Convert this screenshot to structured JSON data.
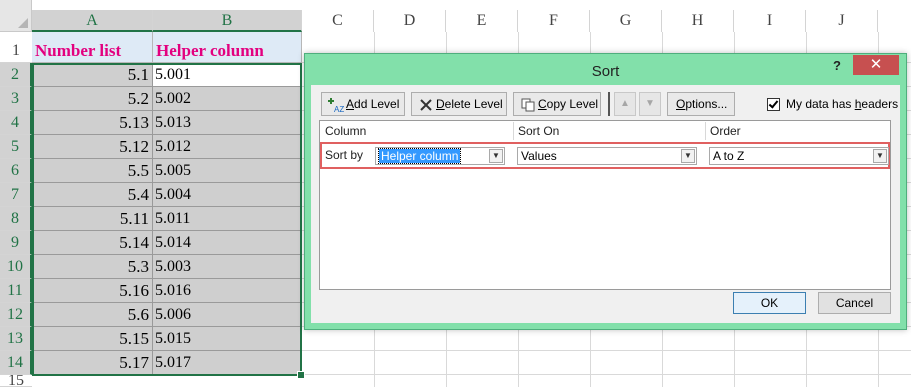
{
  "spreadsheet": {
    "columns": [
      "A",
      "B",
      "C",
      "D",
      "E",
      "F",
      "G",
      "H",
      "I",
      "J"
    ],
    "row_numbers": [
      "1",
      "2",
      "3",
      "4",
      "5",
      "6",
      "7",
      "8",
      "9",
      "10",
      "11",
      "12",
      "13",
      "14",
      "15"
    ],
    "header_row": {
      "a": "Number list",
      "b": "Helper column"
    },
    "rows": [
      {
        "a": "5.1",
        "b": "5.001"
      },
      {
        "a": "5.2",
        "b": "5.002"
      },
      {
        "a": "5.13",
        "b": "5.013"
      },
      {
        "a": "5.12",
        "b": "5.012"
      },
      {
        "a": "5.5",
        "b": "5.005"
      },
      {
        "a": "5.4",
        "b": "5.004"
      },
      {
        "a": "5.11",
        "b": "5.011"
      },
      {
        "a": "5.14",
        "b": "5.014"
      },
      {
        "a": "5.3",
        "b": "5.003"
      },
      {
        "a": "5.16",
        "b": "5.016"
      },
      {
        "a": "5.6",
        "b": "5.006"
      },
      {
        "a": "5.15",
        "b": "5.015"
      },
      {
        "a": "5.17",
        "b": "5.017"
      }
    ],
    "colors": {
      "header_text": "#e3007f",
      "header_fill": "#deeaf6",
      "selection": "#217346",
      "selected_fill": "#cfcfcf"
    }
  },
  "sort_dialog": {
    "title": "Sort",
    "help": "?",
    "close": "✕",
    "toolbar": {
      "add_level": {
        "accel": "A",
        "rest": "dd Level",
        "icon": "add-level-icon"
      },
      "delete_level": {
        "accel": "D",
        "rest": "elete Level",
        "icon": "delete-level-icon"
      },
      "copy_level": {
        "accel": "C",
        "rest": "opy Level",
        "icon": "copy-level-icon"
      },
      "move_up": "▲",
      "move_down": "▼",
      "options": {
        "accel": "O",
        "rest": "ptions..."
      },
      "headers_checkbox": {
        "pre": "My data has ",
        "accel": "h",
        "rest": "eaders",
        "checked": true
      }
    },
    "columns": {
      "column": "Column",
      "sort_on": "Sort On",
      "order": "Order"
    },
    "level": {
      "sort_by": "Sort by",
      "column_value": "Helper column",
      "sort_on_value": "Values",
      "order_value": "A to Z"
    },
    "ok": "OK",
    "cancel": "Cancel",
    "colors": {
      "dialog_frame": "#82e0aa",
      "close": "#c75050",
      "highlight_border": "#e06060"
    }
  }
}
